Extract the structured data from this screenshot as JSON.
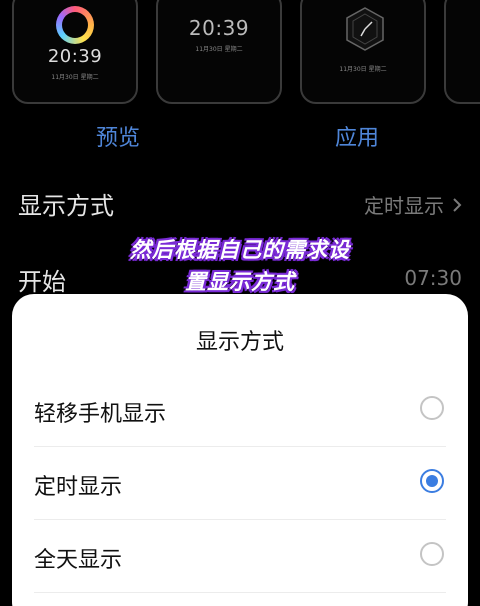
{
  "previews": [
    {
      "time": "20:39",
      "date": "11月30日 星期二"
    },
    {
      "time": "20:39",
      "date": "11月30日 星期二"
    },
    {
      "time": "",
      "date": "11月30日 星期二"
    }
  ],
  "actions": {
    "preview": "预览",
    "apply": "应用"
  },
  "settings": {
    "display_mode": {
      "label": "显示方式",
      "value": "定时显示"
    },
    "start": {
      "label": "开始",
      "value": "07:30"
    }
  },
  "caption": {
    "line1": "然后根据自己的需求设",
    "line2": "置显示方式"
  },
  "sheet": {
    "title": "显示方式",
    "options": [
      {
        "label": "轻移手机显示",
        "selected": false
      },
      {
        "label": "定时显示",
        "selected": true
      },
      {
        "label": "全天显示",
        "selected": false
      }
    ]
  },
  "colors": {
    "accent": "#3b7de1",
    "link": "#4f86d9",
    "background": "#000000",
    "sheet": "#ffffff"
  }
}
